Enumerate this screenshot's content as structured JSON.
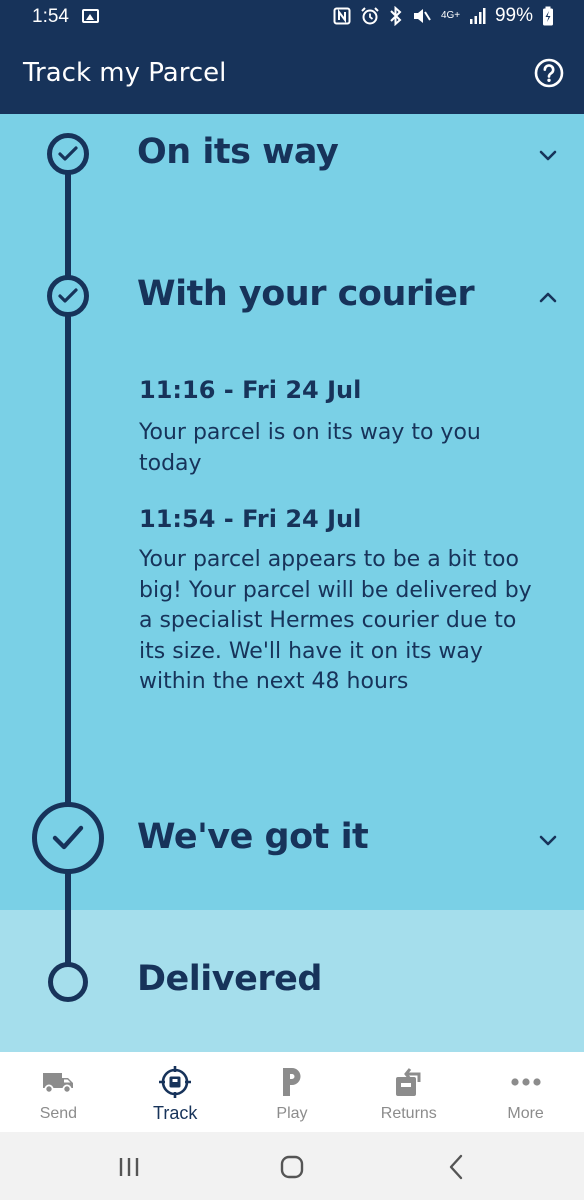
{
  "status_bar": {
    "time": "1:54",
    "network": "4G+",
    "battery": "99%"
  },
  "header": {
    "title": "Track my Parcel"
  },
  "colors": {
    "navy": "#17335a",
    "sky": "#7ad0e6",
    "sky_light": "#a5deec",
    "inactive_nav": "#8c8c8c"
  },
  "timeline": {
    "steps": [
      {
        "title": "On its way",
        "state": "done",
        "expanded": false
      },
      {
        "title": "With your courier",
        "state": "done",
        "expanded": true,
        "events": [
          {
            "time": "11:16 - Fri 24 Jul",
            "text": "Your parcel is on its way to you today"
          },
          {
            "time": "11:54 - Fri 24 Jul",
            "text": "Your parcel appears to be a bit too big! Your parcel will be delivered by a specialist Hermes courier due to its size. We'll have it on its way within the next 48 hours"
          }
        ]
      },
      {
        "title": "We've got it",
        "state": "done",
        "expanded": false
      },
      {
        "title": "Delivered",
        "state": "pending",
        "expanded": false
      }
    ]
  },
  "bottom_nav": {
    "items": [
      {
        "label": "Send",
        "icon": "van-icon",
        "active": false
      },
      {
        "label": "Track",
        "icon": "track-target-icon",
        "active": true
      },
      {
        "label": "Play",
        "icon": "play-p-icon",
        "active": false
      },
      {
        "label": "Returns",
        "icon": "returns-box-icon",
        "active": false
      },
      {
        "label": "More",
        "icon": "more-dots-icon",
        "active": false
      }
    ]
  }
}
